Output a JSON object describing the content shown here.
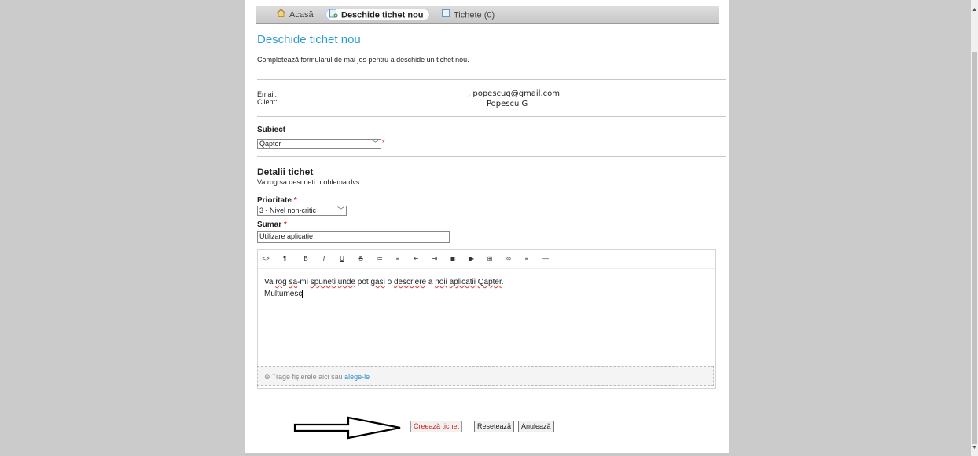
{
  "nav": {
    "home": "Acasă",
    "new_ticket": "Deschide tichet nou",
    "tickets": "Tichete (0)"
  },
  "page_title": "Deschide tichet nou",
  "intro": "Completează formularul de mai jos pentru a deschide un tichet nou.",
  "contact": {
    "email_label": "Email:",
    "email_value": ", popescug@gmail.com",
    "client_label": "Client:",
    "client_value": "Popescu G"
  },
  "subject": {
    "heading": "Subiect",
    "selected": "Qapter",
    "required_mark": "*"
  },
  "details": {
    "heading": "Detalii tichet",
    "subheading": "Va rog sa descrieti problema dvs.",
    "priority_label": "Prioritate",
    "priority_value": "3 - Nivel non-critic",
    "summary_label": "Sumar",
    "summary_value": "Utilizare aplicatie",
    "required_mark": "*"
  },
  "editor": {
    "toolbar_icons": [
      "code-icon",
      "paragraph-icon",
      "bold-icon",
      "italic-icon",
      "underline-icon",
      "strikethrough-icon",
      "unordered-list-icon",
      "ordered-list-icon",
      "outdent-icon",
      "indent-icon",
      "image-icon",
      "video-icon",
      "table-icon",
      "link-icon",
      "align-icon",
      "horizontal-rule-icon"
    ],
    "toolbar_glyphs": [
      "<>",
      "¶",
      "B",
      "I",
      "U",
      "S",
      "≔",
      "≡",
      "⇤",
      "⇥",
      "▣",
      "▶",
      "⊞",
      "∞",
      "≡",
      "—"
    ],
    "line1_parts": [
      "Va ",
      "rog",
      " ",
      "sa",
      "-mi ",
      "spuneti",
      " ",
      "unde",
      " pot ",
      "gasi",
      " o ",
      "descriere",
      " a ",
      "noii",
      " ",
      "aplicatii",
      " ",
      "Qapter",
      "."
    ],
    "line2": "Multumesc"
  },
  "dropzone": {
    "text": "⊕ Trage fișierele aici sau ",
    "link": "alege-le"
  },
  "buttons": {
    "create": "Creează tichet",
    "reset": "Resetează",
    "cancel": "Anulează"
  }
}
